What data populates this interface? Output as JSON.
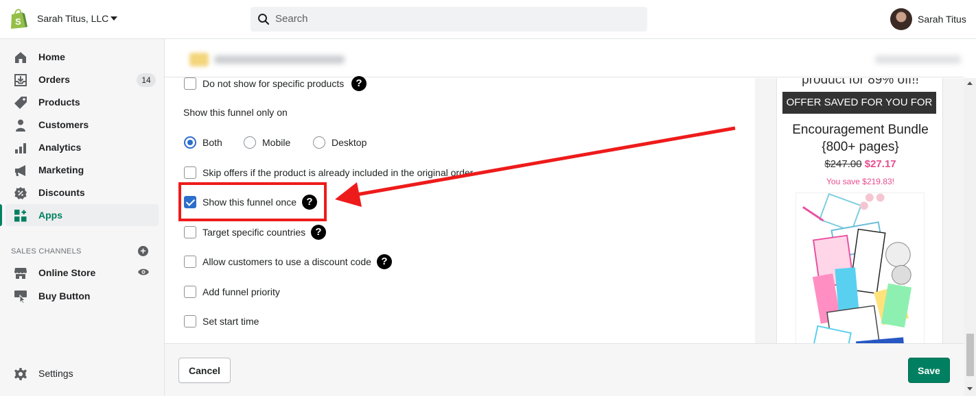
{
  "topbar": {
    "store_name": "Sarah Titus, LLC",
    "search_placeholder": "Search",
    "user_name": "Sarah Titus"
  },
  "sidebar": {
    "items": [
      {
        "label": "Home",
        "icon": "home-icon"
      },
      {
        "label": "Orders",
        "icon": "orders-icon",
        "badge": "14"
      },
      {
        "label": "Products",
        "icon": "tag-icon"
      },
      {
        "label": "Customers",
        "icon": "person-icon"
      },
      {
        "label": "Analytics",
        "icon": "bar-chart-icon"
      },
      {
        "label": "Marketing",
        "icon": "megaphone-icon"
      },
      {
        "label": "Discounts",
        "icon": "discount-icon"
      },
      {
        "label": "Apps",
        "icon": "apps-icon",
        "active": true
      }
    ],
    "sales_channels_title": "SALES CHANNELS",
    "channels": [
      {
        "label": "Online Store",
        "icon": "store-icon"
      },
      {
        "label": "Buy Button",
        "icon": "buy-button-icon"
      }
    ],
    "settings_label": "Settings"
  },
  "form": {
    "opt_not_specific_products": "Do not show for specific products",
    "show_only_on_label": "Show this funnel only on",
    "radio_both": "Both",
    "radio_mobile": "Mobile",
    "radio_desktop": "Desktop",
    "radio_selected": "Both",
    "opt_skip_offers": "Skip offers if the product is already included in the original order",
    "opt_show_once": "Show this funnel once",
    "opt_show_once_checked": true,
    "opt_target_countries": "Target specific countries",
    "opt_discount_code": "Allow customers to use a discount code",
    "opt_funnel_priority": "Add funnel priority",
    "opt_start_time": "Set start time",
    "help_glyph": "?"
  },
  "preview": {
    "top_text": "product for 89% off!!",
    "banner": "OFFER SAVED FOR YOU FOR",
    "title": "Encouragement Bundle {800+ pages}",
    "old_price": "$247.00",
    "new_price": "$27.17",
    "you_save": "You save $219.83!"
  },
  "footer": {
    "cancel_label": "Cancel",
    "save_label": "Save"
  },
  "colors": {
    "accent": "#008060",
    "checkbox": "#2c6ecb",
    "annotation": "#ee1b1b",
    "price": "#e54c8f"
  }
}
